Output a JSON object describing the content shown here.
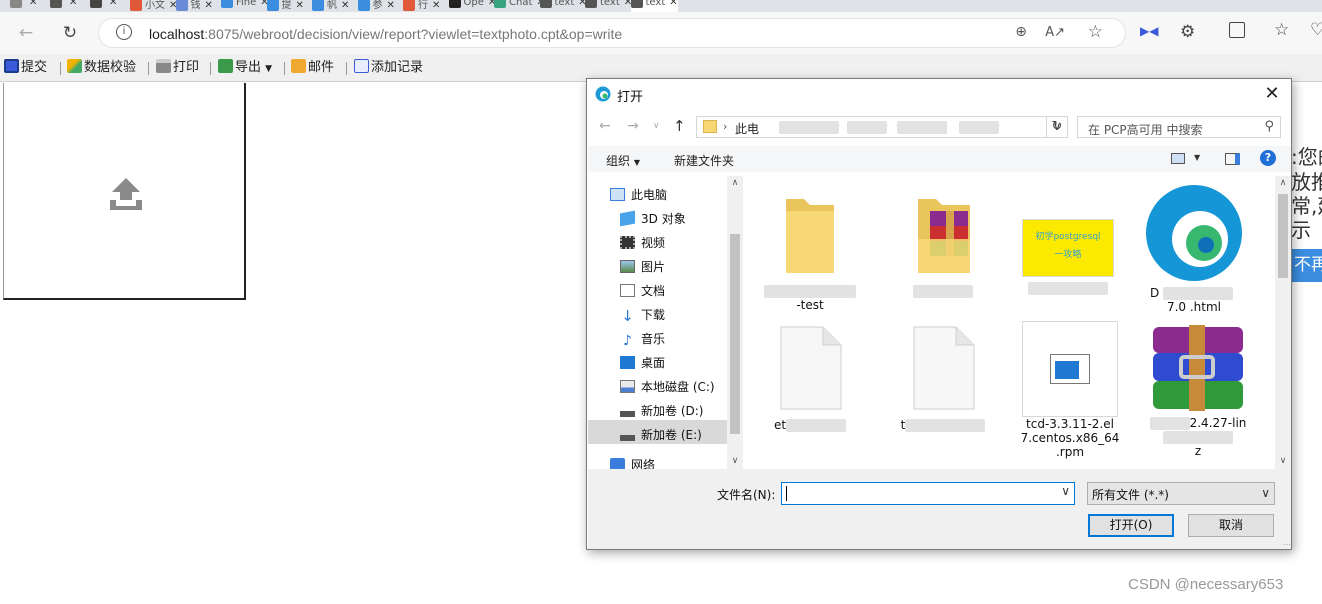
{
  "browser": {
    "tabs": [
      {
        "label": "",
        "color": "#888888"
      },
      {
        "label": "",
        "color": "#555555"
      },
      {
        "label": "",
        "color": "#444444"
      },
      {
        "label": "小文",
        "color": "#e05a3a"
      },
      {
        "label": "钱",
        "color": "#6a8bd6"
      },
      {
        "label": "Fine",
        "color": "#3b8de0"
      },
      {
        "label": "提",
        "color": "#3b8de0"
      },
      {
        "label": "帆",
        "color": "#3b8de0"
      },
      {
        "label": "参",
        "color": "#3b8de0"
      },
      {
        "label": "行",
        "color": "#e05a3a"
      },
      {
        "label": "Ope",
        "color": "#222222"
      },
      {
        "label": "Chat",
        "color": "#3aa37f"
      },
      {
        "label": "text",
        "color": "#555555"
      },
      {
        "label": "text",
        "color": "#555555"
      },
      {
        "label": "text",
        "color": "#555555"
      }
    ],
    "url_host": "localhost",
    "url_rest": ":8075/webroot/decision/view/report?viewlet=textphoto.cpt&op=write"
  },
  "toolbar": {
    "submit": "提交",
    "validate": "数据校验",
    "print": "打印",
    "export": "导出",
    "mail": "邮件",
    "add_record": "添加记录"
  },
  "page": {
    "clipped_lines": [
      ":您的",
      "放推",
      "常,建",
      "示"
    ],
    "clipped_button": "不再",
    "watermark": "CSDN @necessary653"
  },
  "dialog": {
    "title": "打开",
    "path_root": "此电",
    "search_placeholder": "在 PCP高可用 中搜索",
    "organize": "组织",
    "new_folder": "新建文件夹",
    "nav": [
      "此电脑",
      "3D 对象",
      "视频",
      "图片",
      "文档",
      "下载",
      "音乐",
      "桌面",
      "本地磁盘 (C:)",
      "新加卷 (D:)",
      "新加卷 (E:)",
      "网络"
    ],
    "files": [
      {
        "name": "-test",
        "kind": "folder"
      },
      {
        "name": "",
        "kind": "folder-archive"
      },
      {
        "name": "",
        "kind": "image",
        "thumb_line1": "初学postgresql",
        "thumb_line2": "一攻略"
      },
      {
        "name": "D",
        "name2": "7.0  .html",
        "kind": "edge"
      },
      {
        "name": "et",
        "kind": "blank"
      },
      {
        "name": "t",
        "kind": "blank"
      },
      {
        "name": "tcd-3.3.11-2.el",
        "name2": "7.centos.x86_64",
        "name3": ".rpm",
        "kind": "rpm"
      },
      {
        "name": "2.4.27-lin",
        "name2": "z",
        "kind": "rar"
      }
    ],
    "filename_label": "文件名(N):",
    "filename_value": "",
    "filetype": "所有文件 (*.*)",
    "open_button": "打开(O)",
    "cancel_button": "取消"
  },
  "colors": {
    "accent": "#0078d7",
    "folder": "#f8d775",
    "upload_icon": "#8a8a8a"
  }
}
